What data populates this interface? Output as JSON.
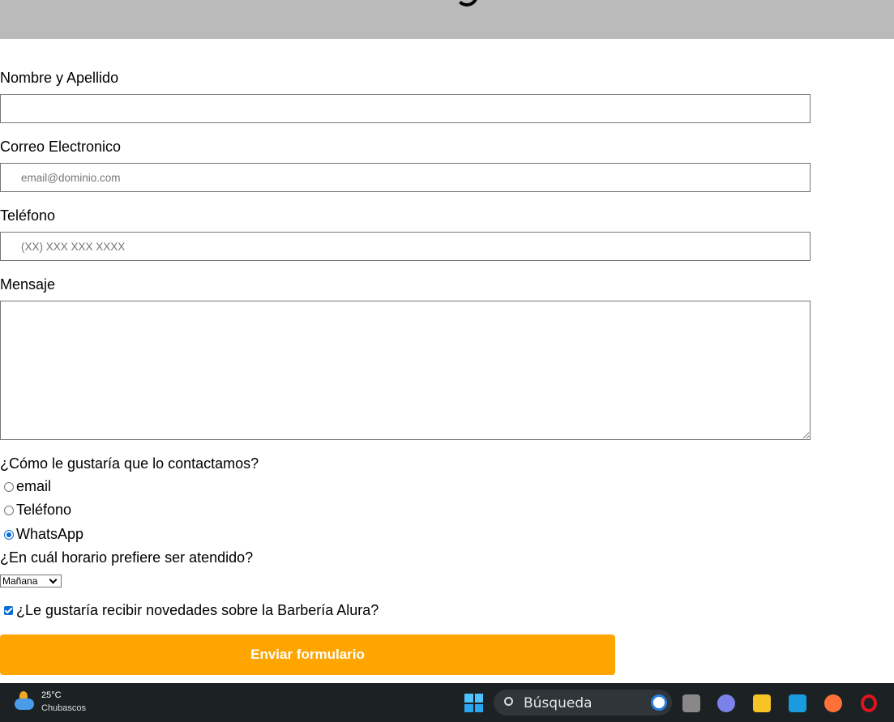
{
  "form": {
    "name_label": "Nombre y Apellido",
    "name_value": "",
    "email_label": "Correo Electronico",
    "email_placeholder": "email@dominio.com",
    "phone_label": "Teléfono",
    "phone_placeholder": "(XX) XXX XXX XXXX",
    "message_label": "Mensaje",
    "contact_question": "¿Cómo le gustaría que lo contactamos?",
    "contact_options": [
      {
        "label": "email",
        "checked": false
      },
      {
        "label": "Teléfono",
        "checked": false
      },
      {
        "label": "WhatsApp",
        "checked": true
      }
    ],
    "schedule_question": "¿En cuál horario prefiere ser atendido?",
    "schedule_selected": "Mañana",
    "newsletter_label": "¿Le gustaría recibir novedades sobre la Barbería Alura?",
    "newsletter_checked": true,
    "submit_label": "Enviar formulario",
    "accent_color": "#ffa500"
  },
  "taskbar": {
    "temperature": "25°C",
    "weather": "Chubascos",
    "search_label": "Búsqueda",
    "icons": [
      "weather-icon",
      "windows-start-icon",
      "search-icon",
      "bing-icon",
      "task-view-icon",
      "teams-chat-icon",
      "file-explorer-icon",
      "mail-icon",
      "firefox-icon",
      "opera-icon"
    ]
  }
}
